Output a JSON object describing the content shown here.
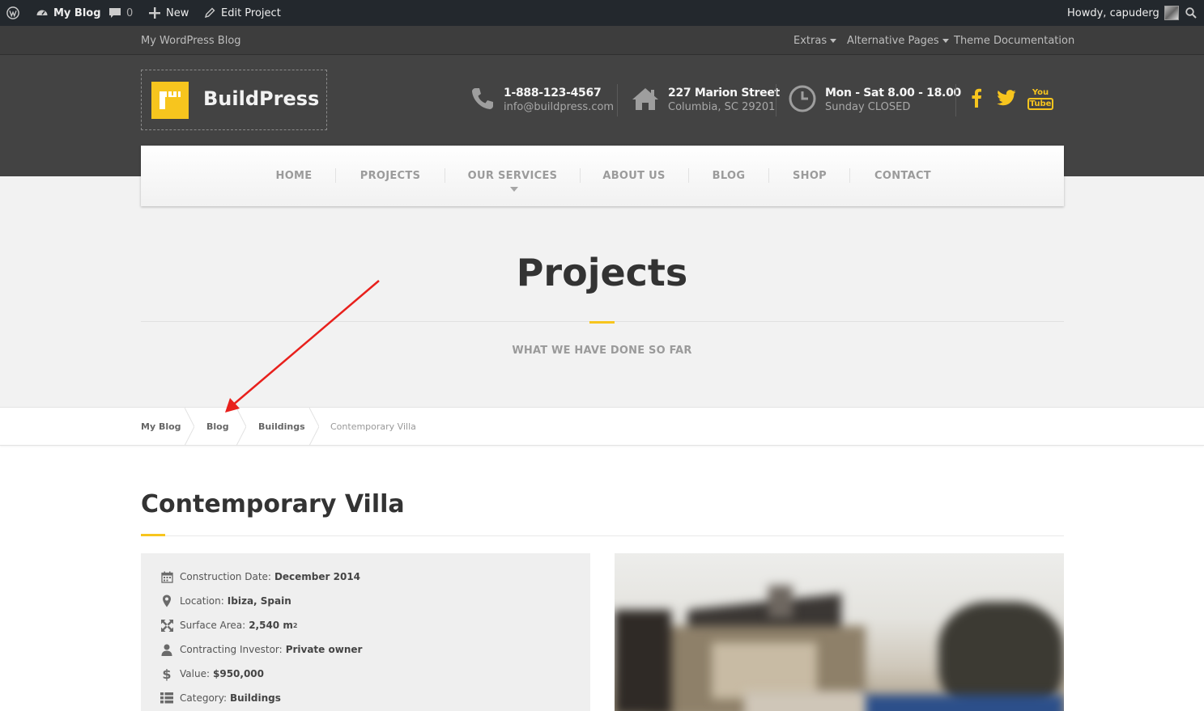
{
  "admin_bar": {
    "site_name": "My Blog",
    "comments_count": "0",
    "new_label": "New",
    "edit_label": "Edit Project",
    "greeting": "Howdy, capuderg"
  },
  "top_bar": {
    "tagline": "My WordPress Blog",
    "menu": [
      "Extras",
      "Alternative Pages",
      "Theme Documentation"
    ]
  },
  "header": {
    "logo_text": "BuildPress",
    "phone": "1-888-123-4567",
    "email": "info@buildpress.com",
    "address_line1": "227 Marion Street",
    "address_line2": "Columbia, SC 29201",
    "hours_line1": "Mon - Sat 8.00 - 18.00",
    "hours_line2": "Sunday CLOSED",
    "social": [
      "facebook-icon",
      "twitter-icon",
      "youtube-icon"
    ],
    "youtube_text_top": "You",
    "youtube_text_bottom": "Tube"
  },
  "nav": {
    "items": [
      "HOME",
      "PROJECTS",
      "OUR SERVICES",
      "ABOUT US",
      "BLOG",
      "SHOP",
      "CONTACT"
    ]
  },
  "hero": {
    "title": "Projects",
    "subtitle": "WHAT WE HAVE DONE SO FAR"
  },
  "breadcrumbs": [
    "My Blog",
    "Blog",
    "Buildings",
    "Contemporary Villa"
  ],
  "project": {
    "title": "Contemporary Villa",
    "details": [
      {
        "icon": "calendar-icon",
        "label": "Construction Date:",
        "value": "December 2014"
      },
      {
        "icon": "map-marker-icon",
        "label": "Location:",
        "value": "Ibiza, Spain"
      },
      {
        "icon": "expand-icon",
        "label": "Surface Area:",
        "value": "2,540 m",
        "sup": "2"
      },
      {
        "icon": "user-icon",
        "label": "Contracting Investor:",
        "value": "Private owner"
      },
      {
        "icon": "dollar-icon",
        "label": "Value:",
        "value": "$950,000"
      },
      {
        "icon": "list-icon",
        "label": "Category:",
        "value": "Buildings"
      }
    ]
  },
  "colors": {
    "accent": "#f7c51e",
    "admin_bar": "#23282d",
    "header": "#434343",
    "annotation": "#e8201c"
  }
}
